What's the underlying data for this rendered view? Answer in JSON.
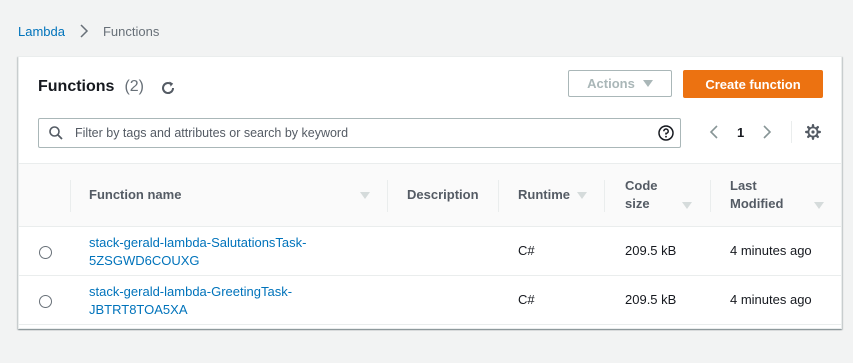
{
  "breadcrumb": {
    "root": "Lambda",
    "current": "Functions"
  },
  "header": {
    "title": "Functions",
    "count": "(2)",
    "actions_label": "Actions",
    "create_label": "Create function"
  },
  "search": {
    "placeholder": "Filter by tags and attributes or search by keyword"
  },
  "pagination": {
    "page": "1"
  },
  "table": {
    "columns": [
      {
        "label": "Function name"
      },
      {
        "label": "Description"
      },
      {
        "label": "Runtime"
      },
      {
        "label": "Code size"
      },
      {
        "label": "Last Modified"
      }
    ],
    "rows": [
      {
        "name_line1": "stack-gerald-lambda-SalutationsTask-",
        "name_line2": "5ZSGWD6COUXG",
        "description": "",
        "runtime": "C#",
        "code_size": "209.5 kB",
        "last_modified": "4 minutes ago"
      },
      {
        "name_line1": "stack-gerald-lambda-GreetingTask-",
        "name_line2": "JBTRT8TOA5XA",
        "description": "",
        "runtime": "C#",
        "code_size": "209.5 kB",
        "last_modified": "4 minutes ago"
      }
    ]
  },
  "colors": {
    "accent": "#ec7211",
    "link": "#0073bb",
    "background": "#f2f3f3"
  },
  "icons": [
    "chevron-right-icon",
    "refresh-icon",
    "caret-down-icon",
    "search-icon",
    "help-icon",
    "chevron-left-icon",
    "settings-gear-icon",
    "sort-icon"
  ]
}
